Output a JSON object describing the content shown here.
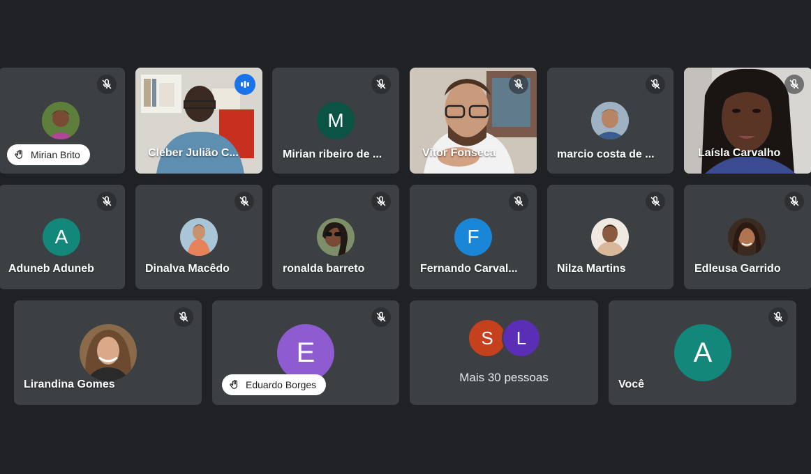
{
  "meeting": {
    "accent_color": "#8ab4f8",
    "tile_color": "#3c4043",
    "background_color": "#202124",
    "participants": [
      {
        "name": "Mirian Brito",
        "muted": true,
        "hand_raised": true,
        "avatar": "photo"
      },
      {
        "name": "Cleber Julião C...",
        "muted": false,
        "speaking": true,
        "avatar": "video"
      },
      {
        "name": "Mirian ribeiro de ...",
        "muted": true,
        "avatar_letter": "M",
        "avatar_color": "#0b5345"
      },
      {
        "name": "Vitor Fonseca",
        "muted": true,
        "avatar": "video"
      },
      {
        "name": "marcio costa de ...",
        "muted": true,
        "avatar": "photo"
      },
      {
        "name": "Laísla Carvalho",
        "muted": true,
        "avatar": "video"
      },
      {
        "name": "Aduneb Aduneb",
        "muted": true,
        "avatar_letter": "A",
        "avatar_color": "#12877a"
      },
      {
        "name": "Dinalva Macêdo",
        "muted": true,
        "avatar": "photo"
      },
      {
        "name": "ronalda barreto",
        "muted": true,
        "avatar": "photo"
      },
      {
        "name": "Fernando Carval...",
        "muted": true,
        "avatar_letter": "F",
        "avatar_color": "#1a86d8"
      },
      {
        "name": "Nilza Martins",
        "muted": true,
        "avatar": "photo"
      },
      {
        "name": "Edleusa Garrido",
        "muted": true,
        "avatar": "photo"
      },
      {
        "name": "Lirandina Gomes",
        "muted": true,
        "avatar": "photo"
      },
      {
        "name": "Eduardo Borges",
        "muted": true,
        "hand_raised": true,
        "avatar_letter": "E",
        "avatar_color": "#8e5bd1"
      },
      {
        "name": "Você",
        "muted": true,
        "avatar_letter": "A",
        "avatar_color": "#12877a"
      }
    ],
    "more": {
      "label": "Mais 30 pessoas",
      "letters": [
        {
          "letter": "S",
          "color": "#c5401c"
        },
        {
          "letter": "L",
          "color": "#5b2fb5"
        }
      ]
    }
  }
}
